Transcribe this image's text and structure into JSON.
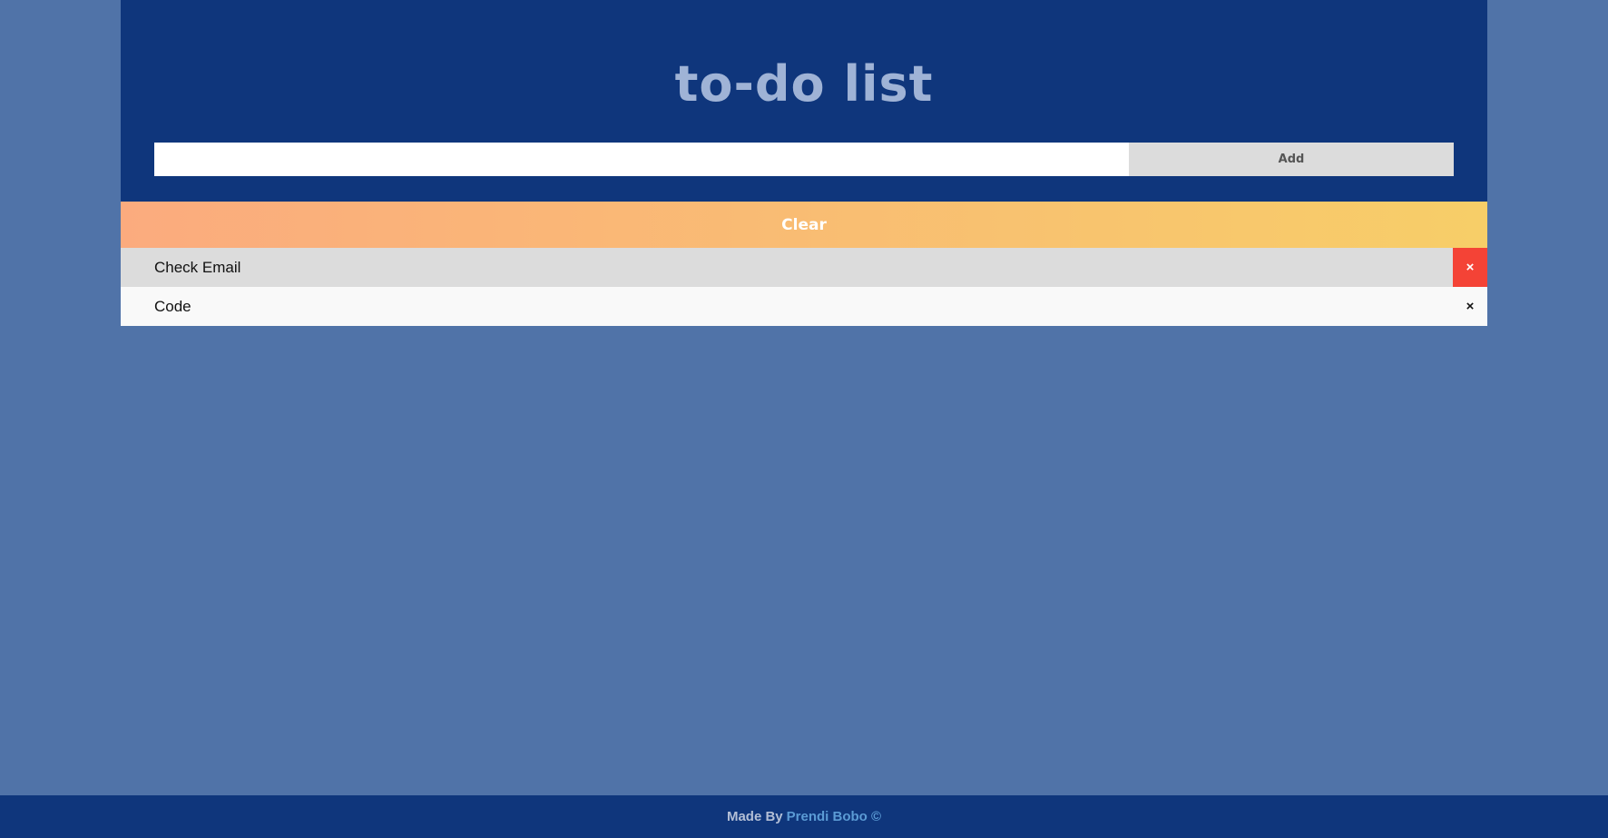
{
  "app": {
    "title": "to-do list"
  },
  "input": {
    "value": "",
    "placeholder": ""
  },
  "buttons": {
    "add_label": "Add",
    "clear_label": "Clear"
  },
  "todos": [
    {
      "text": "Check Email",
      "delete_icon": "×"
    },
    {
      "text": "Code",
      "delete_icon": "×"
    }
  ],
  "footer": {
    "made_by": "Made By",
    "author": "Prendi Bobo ©"
  },
  "colors": {
    "background": "#5073a8",
    "header": "#0f367c",
    "title": "#9fb3d6",
    "clear_gradient_start": "#fbab7e",
    "clear_gradient_end": "#f7ce68",
    "delete_active": "#f44336",
    "footer_link": "#5b9bd5"
  }
}
